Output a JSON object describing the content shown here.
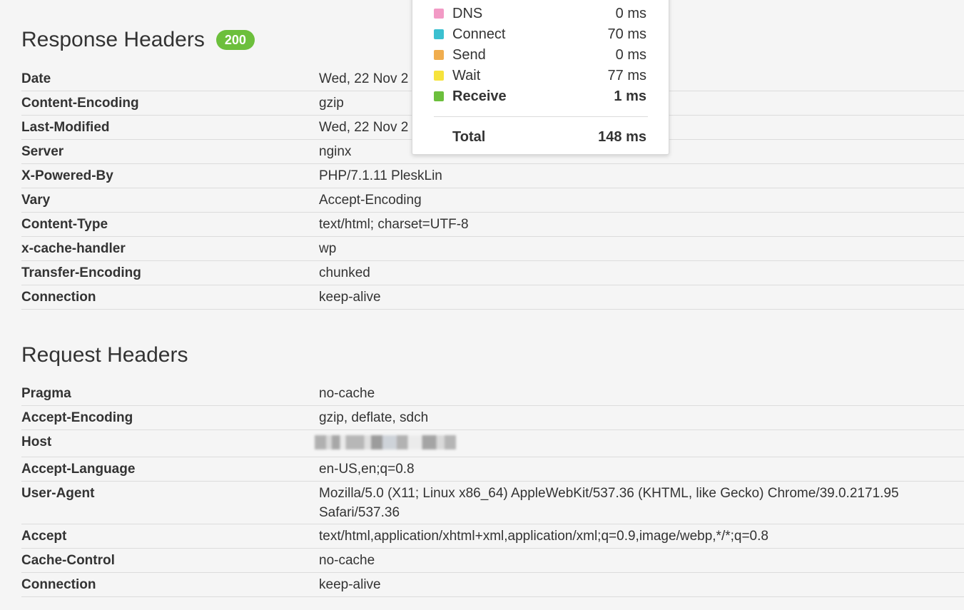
{
  "response_headers": {
    "title": "Response Headers",
    "status_code": "200",
    "rows": [
      {
        "name": "Date",
        "value": "Wed, 22 Nov 2"
      },
      {
        "name": "Content-Encoding",
        "value": "gzip"
      },
      {
        "name": "Last-Modified",
        "value": "Wed, 22 Nov 2"
      },
      {
        "name": "Server",
        "value": "nginx"
      },
      {
        "name": "X-Powered-By",
        "value": "PHP/7.1.11 PleskLin"
      },
      {
        "name": "Vary",
        "value": "Accept-Encoding"
      },
      {
        "name": "Content-Type",
        "value": "text/html; charset=UTF-8"
      },
      {
        "name": "x-cache-handler",
        "value": "wp"
      },
      {
        "name": "Transfer-Encoding",
        "value": "chunked"
      },
      {
        "name": "Connection",
        "value": "keep-alive"
      }
    ]
  },
  "request_headers": {
    "title": "Request Headers",
    "rows": [
      {
        "name": "Pragma",
        "value": "no-cache"
      },
      {
        "name": "Accept-Encoding",
        "value": "gzip, deflate, sdch"
      },
      {
        "name": "Host",
        "value": ""
      },
      {
        "name": "Accept-Language",
        "value": "en-US,en;q=0.8"
      },
      {
        "name": "User-Agent",
        "value": "Mozilla/5.0 (X11; Linux x86_64) AppleWebKit/537.36 (KHTML, like Gecko) Chrome/39.0.2171.95 Safari/537.36"
      },
      {
        "name": "Accept",
        "value": "text/html,application/xhtml+xml,application/xml;q=0.9,image/webp,*/*;q=0.8"
      },
      {
        "name": "Cache-Control",
        "value": "no-cache"
      },
      {
        "name": "Connection",
        "value": "keep-alive"
      }
    ]
  },
  "timing": {
    "phases": [
      {
        "label": "DNS",
        "value": "0 ms",
        "color": "#f29ac5"
      },
      {
        "label": "Connect",
        "value": "70 ms",
        "color": "#3bc0d0"
      },
      {
        "label": "Send",
        "value": "0 ms",
        "color": "#f0ad4e"
      },
      {
        "label": "Wait",
        "value": "77 ms",
        "color": "#f6e33c"
      },
      {
        "label": "Receive",
        "value": "1 ms",
        "color": "#6cbf3c"
      }
    ],
    "total_label": "Total",
    "total_value": "148 ms"
  },
  "colors": {
    "badge": "#6cbf3c",
    "row_divider": "#dcdcdc"
  }
}
